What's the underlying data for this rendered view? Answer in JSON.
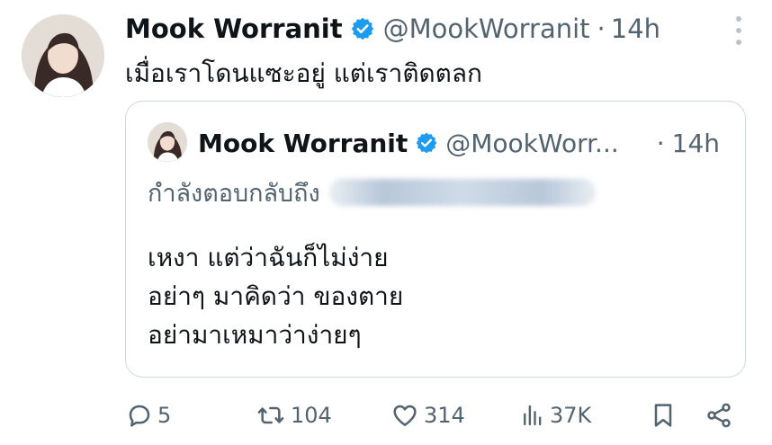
{
  "tweet": {
    "author_name": "Mook Worranit",
    "handle": "@MookWorranit",
    "separator": "·",
    "time": "14h",
    "text": "เมื่อเราโดนแซะอยู่ แต่เราติดตลก"
  },
  "quote": {
    "author_name": "Mook Worranit",
    "handle": "@MookWorr...",
    "separator": "·",
    "time": "14h",
    "replying_to_label": "กำลังตอบกลับถึง",
    "lines": [
      "เหงา แต่ว่าฉันก็ไม่ง่าย",
      "อย่าๆ มาคิดว่า ของตาย",
      "อย่ามาเหมาว่าง่ายๆ"
    ]
  },
  "actions": {
    "replies": "5",
    "retweets": "104",
    "likes": "314",
    "views": "37K"
  },
  "colors": {
    "text": "#0f1419",
    "muted": "#536471",
    "verified": "#1d9bf0",
    "border": "#cfd9de"
  },
  "icons": [
    "verified-badge-icon",
    "more-icon",
    "reply-icon",
    "retweet-icon",
    "like-icon",
    "views-icon",
    "bookmark-icon",
    "share-icon"
  ]
}
